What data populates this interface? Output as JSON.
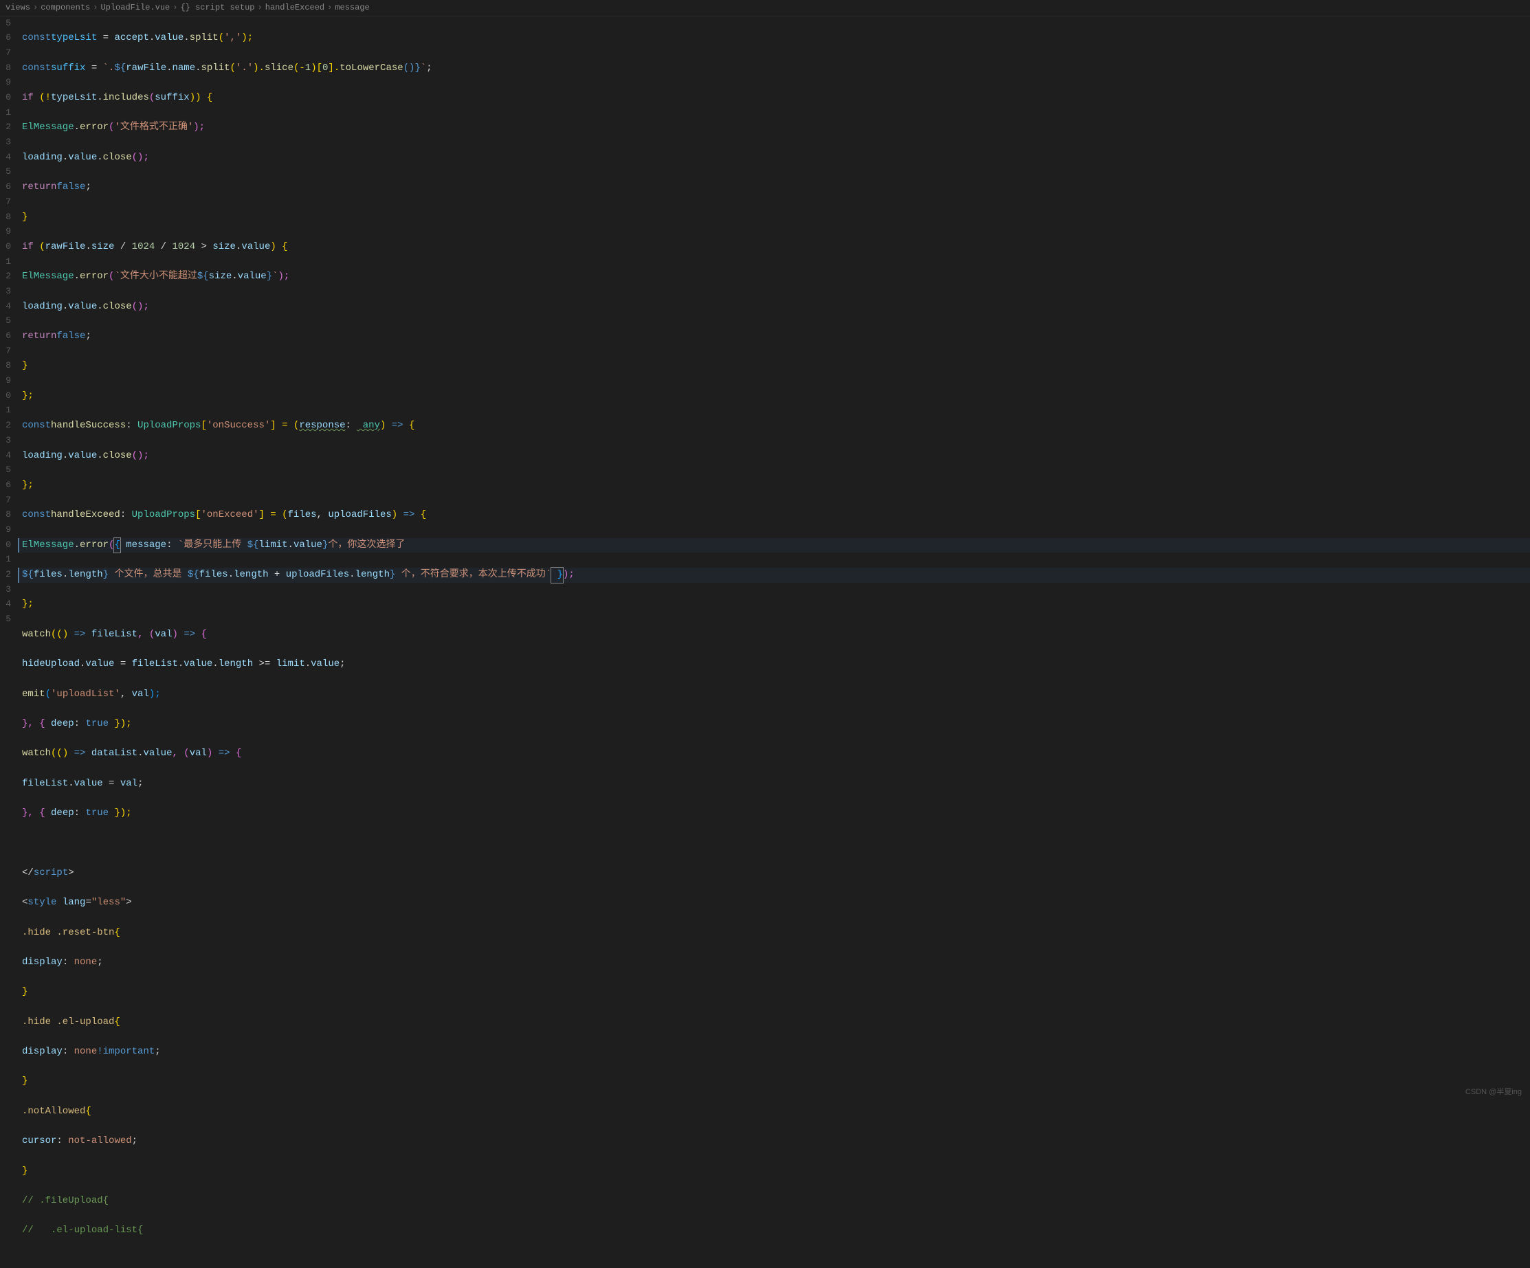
{
  "breadcrumb": {
    "items": [
      "views",
      "components",
      "UploadFile.vue",
      "{} script setup",
      "handleExceed",
      "message"
    ]
  },
  "lineNumbers": [
    "5",
    "6",
    "7",
    "8",
    "9",
    "0",
    "1",
    "2",
    "3",
    "4",
    "5",
    "6",
    "7",
    "8",
    "9",
    "0",
    "1",
    "2",
    "3",
    "4",
    "5",
    "6",
    "7",
    "8",
    "9",
    "0",
    "1",
    "2",
    "3",
    "4",
    "5",
    "6",
    "7",
    "8",
    "9",
    "0",
    "1",
    "2",
    "3",
    "4",
    "5"
  ],
  "code": {
    "l0_kw1": "const",
    "l0_v1": "typeLsit",
    "l0_p1": " = ",
    "l0_v2": "accept",
    "l0_p2": ".",
    "l0_v3": "value",
    "l0_p3": ".",
    "l0_fn1": "split",
    "l0_p4": "(",
    "l0_s1": "','",
    "l0_p5": ");",
    "l1_kw1": "const",
    "l1_v1": "suffix",
    "l1_p1": " = ",
    "l1_s1": "`.",
    "l1_p2": "${",
    "l1_v2": "rawFile",
    "l1_p3": ".",
    "l1_v3": "name",
    "l1_p4": ".",
    "l1_fn1": "split",
    "l1_p5": "(",
    "l1_s2": "'.'",
    "l1_p6": ").",
    "l1_fn2": "slice",
    "l1_p7": "(-",
    "l1_n1": "1",
    "l1_p8": ")[",
    "l1_n2": "0",
    "l1_p9": "].",
    "l1_fn3": "toLowerCase",
    "l1_p10": "()}",
    "l1_s3": "`",
    "l1_p11": ";",
    "l2_ctrl": "if",
    "l2_p1": " (!",
    "l2_v1": "typeLsit",
    "l2_p2": ".",
    "l2_fn1": "includes",
    "l2_p3": "(",
    "l2_v2": "suffix",
    "l2_p4": ")) {",
    "l3_t1": "ElMessage",
    "l3_p1": ".",
    "l3_fn1": "error",
    "l3_p2": "(",
    "l3_s1": "'文件格式不正确'",
    "l3_p3": ");",
    "l4_v1": "loading",
    "l4_p1": ".",
    "l4_v2": "value",
    "l4_p2": ".",
    "l4_fn1": "close",
    "l4_p3": "();",
    "l5_ctrl": "return",
    "l5_kw": "false",
    "l5_p": ";",
    "l6_p": "}",
    "l7_ctrl": "if",
    "l7_p1": " (",
    "l7_v1": "rawFile",
    "l7_p2": ".",
    "l7_v2": "size",
    "l7_p3": " / ",
    "l7_n1": "1024",
    "l7_p4": " / ",
    "l7_n2": "1024",
    "l7_p5": " > ",
    "l7_v3": "size",
    "l7_p6": ".",
    "l7_v4": "value",
    "l7_p7": ") {",
    "l8_t1": "ElMessage",
    "l8_p1": ".",
    "l8_fn1": "error",
    "l8_p2": "(",
    "l8_s1": "`文件大小不能超过",
    "l8_p3": "${",
    "l8_v1": "size",
    "l8_p4": ".",
    "l8_v2": "value",
    "l8_p5": "}",
    "l8_s2": "`",
    "l8_p6": ");",
    "l9_v1": "loading",
    "l9_p1": ".",
    "l9_v2": "value",
    "l9_p2": ".",
    "l9_fn1": "close",
    "l9_p3": "();",
    "l10_ctrl": "return",
    "l10_kw": "false",
    "l10_p": ";",
    "l11_p": "}",
    "l12_p": "};",
    "l13_kw": "const",
    "l13_fn": "handleSuccess",
    "l13_p1": ": ",
    "l13_t": "UploadProps",
    "l13_p2": "[",
    "l13_s": "'onSuccess'",
    "l13_p3": "] = (",
    "l13_v1": "response",
    "l13_p4": ": ",
    "l13_t2": " any",
    "l13_p5": ") ",
    "l13_kw2": "=>",
    "l13_p6": " {",
    "l14_v1": "loading",
    "l14_p1": ".",
    "l14_v2": "value",
    "l14_p2": ".",
    "l14_fn": "close",
    "l14_p3": "();",
    "l15_p": "};",
    "l16_kw": "const",
    "l16_fn": "handleExceed",
    "l16_p1": ": ",
    "l16_t": "UploadProps",
    "l16_p2": "[",
    "l16_s": "'onExceed'",
    "l16_p3": "] = (",
    "l16_v1": "files",
    "l16_p4": ", ",
    "l16_v2": "uploadFiles",
    "l16_p5": ") ",
    "l16_kw2": "=>",
    "l16_p6": " {",
    "l17_t": "ElMessage",
    "l17_p1": ".",
    "l17_fn": "error",
    "l17_p2": "(",
    "l17_br1": "{",
    "l17_v1": " message",
    "l17_p3": ": ",
    "l17_s1": "`最多只能上传 ",
    "l17_p4": "${",
    "l17_v2": "limit",
    "l17_p5": ".",
    "l17_v3": "value",
    "l17_p6": "}",
    "l17_s2": "个，你这次选择了",
    "l18_p1": "${",
    "l18_v1": "files",
    "l18_p2": ".",
    "l18_v2": "length",
    "l18_p3": "}",
    "l18_s1": " 个文件，总共是 ",
    "l18_p4": "${",
    "l18_v3": "files",
    "l18_p5": ".",
    "l18_v4": "length",
    "l18_p6": " + ",
    "l18_v5": "uploadFiles",
    "l18_p7": ".",
    "l18_v6": "length",
    "l18_p8": "}",
    "l18_s2": " 个，不符合要求，本次上传不成功`",
    "l18_br2": " }",
    "l18_p9": ");",
    "l19_p": "};",
    "l20_fn": "watch",
    "l20_p1": "(() ",
    "l20_kw": "=>",
    "l20_p2": " ",
    "l20_v1": "fileList",
    "l20_p3": ", (",
    "l20_v2": "val",
    "l20_p4": ") ",
    "l20_kw2": "=>",
    "l20_p5": " {",
    "l21_v1": "hideUpload",
    "l21_p1": ".",
    "l21_v2": "value",
    "l21_p2": " = ",
    "l21_v3": "fileList",
    "l21_p3": ".",
    "l21_v4": "value",
    "l21_p4": ".",
    "l21_v5": "length",
    "l21_p5": " >= ",
    "l21_v6": "limit",
    "l21_p6": ".",
    "l21_v7": "value",
    "l21_p7": ";",
    "l22_fn": "emit",
    "l22_p1": "(",
    "l22_s": "'uploadList'",
    "l22_p2": ", ",
    "l22_v": "val",
    "l22_p3": ");",
    "l23_p1": "}, { ",
    "l23_v": "deep",
    "l23_p2": ": ",
    "l23_kw": "true",
    "l23_p3": " });",
    "l24_fn": "watch",
    "l24_p1": "(() ",
    "l24_kw": "=>",
    "l24_p2": " ",
    "l24_v1": "dataList",
    "l24_p3": ".",
    "l24_v2": "value",
    "l24_p4": ", (",
    "l24_v3": "val",
    "l24_p5": ") ",
    "l24_kw2": "=>",
    "l24_p6": " {",
    "l25_v1": "fileList",
    "l25_p1": ".",
    "l25_v2": "value",
    "l25_p2": " = ",
    "l25_v3": "val",
    "l25_p3": ";",
    "l26_p1": "}, { ",
    "l26_v": "deep",
    "l26_p2": ": ",
    "l26_kw": "true",
    "l26_p3": " });",
    "l28_p1": "</",
    "l28_t": "script",
    "l28_p2": ">",
    "l29_p1": "<",
    "l29_t": "style",
    "l29_a": " lang",
    "l29_p2": "=",
    "l29_s": "\"less\"",
    "l29_p3": ">",
    "l30_sel": ".hide .reset-btn",
    "l30_p": "{",
    "l31_prop": "display",
    "l31_p1": ": ",
    "l31_val": "none",
    "l31_p2": ";",
    "l32_p": "}",
    "l33_sel": ".hide .el-upload",
    "l33_p": "{",
    "l34_prop": "display",
    "l34_p1": ": ",
    "l34_val": "none",
    "l34_imp": "!important",
    "l34_p2": ";",
    "l35_p": "}",
    "l36_sel": ".notAllowed",
    "l36_p": "{",
    "l37_prop": "cursor",
    "l37_p1": ": ",
    "l37_val": "not-allowed",
    "l37_p2": ";",
    "l38_p": "}",
    "l39_c": "// .fileUpload{",
    "l40_c": "//   .el-upload-list{"
  },
  "watermark": "CSDN @半夏ing"
}
